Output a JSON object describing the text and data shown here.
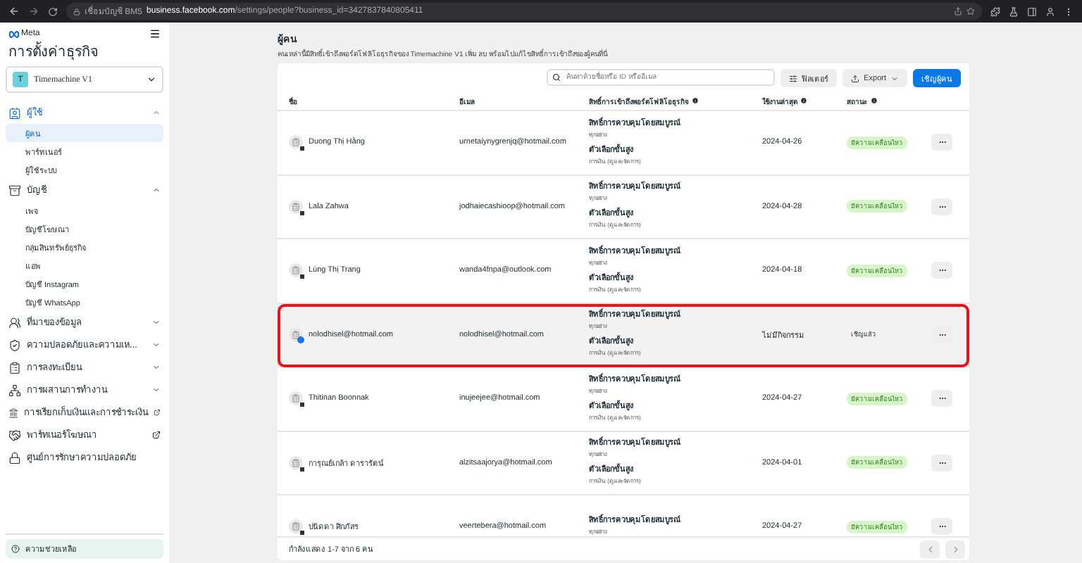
{
  "browser": {
    "site_label": "เชื่อมบัญชี BM5",
    "url_host": "business.facebook.com",
    "url_path": "/settings/people?business_id=3427837840805411"
  },
  "sidebar": {
    "logo": "Meta",
    "title": "การตั้งค่าธุรกิจ",
    "business": {
      "initial": "T",
      "name": "Timemachine V1"
    },
    "sections": [
      {
        "label": "ผู้ใช้",
        "expanded": true,
        "selected": true,
        "external": false,
        "children": [
          {
            "label": "ผู้คน",
            "selected": true
          },
          {
            "label": "พาร์ทเนอร์",
            "selected": false
          },
          {
            "label": "ผู้ใช้ระบบ",
            "selected": false
          }
        ]
      },
      {
        "label": "บัญชี",
        "expanded": true,
        "selected": false,
        "external": false,
        "children": [
          {
            "label": "เพจ",
            "selected": false
          },
          {
            "label": "บัญชีโฆษณา",
            "selected": false
          },
          {
            "label": "กลุ่มสินทรัพย์ธุรกิจ",
            "selected": false
          },
          {
            "label": "แอพ",
            "selected": false
          },
          {
            "label": "บัญชี Instagram",
            "selected": false
          },
          {
            "label": "บัญชี WhatsApp",
            "selected": false
          }
        ]
      },
      {
        "label": "ที่มาของข้อมูล",
        "expanded": false,
        "selected": false,
        "external": false
      },
      {
        "label": "ความปลอดภัยและความเห...",
        "expanded": false,
        "selected": false,
        "external": false
      },
      {
        "label": "การลงทะเบียน",
        "expanded": false,
        "selected": false,
        "external": false
      },
      {
        "label": "การผสานการทำงาน",
        "expanded": false,
        "selected": false,
        "external": false
      },
      {
        "label": "การเรียกเก็บเงินและการชำระเงิน",
        "selected": false,
        "external": true
      },
      {
        "label": "พาร์ทเนอร์โฆษณา",
        "selected": false,
        "external": true
      },
      {
        "label": "ศูนย์การรักษาความปลอดภัย",
        "selected": false,
        "external": false
      }
    ],
    "help": "ความช่วยเหลือ"
  },
  "page": {
    "title": "ผู้คน",
    "subtitle": "คนเหล่านี้มีสิทธิ์เข้าถึงพอร์ตโฟลิโอธุรกิจของ Timemachine V1 เพิ่ม ลบ พร้อมไปแก้ไขสิทธิ์การเข้าถึงของผู้คนที่นี่"
  },
  "toolbar": {
    "search_placeholder": "ค้นหาด้วยชื่อหรือ ID หรืออีเมล",
    "filter": "ฟิลเตอร์",
    "export": "Export",
    "invite": "เชิญผู้คน"
  },
  "table": {
    "columns": [
      {
        "label": "ชื่อ",
        "info": false
      },
      {
        "label": "อีเมล",
        "info": false
      },
      {
        "label": "สิทธิ์การเข้าถึงพอร์ตโฟลิโอธุรกิจ",
        "info": true
      },
      {
        "label": "ใช้งานล่าสุด",
        "info": true
      },
      {
        "label": "สถานะ",
        "info": true
      }
    ],
    "rows": [
      {
        "name": "Duong Thị Hằng",
        "kind": "user",
        "email": "urnetaiynygrenjq@hotmail.com",
        "access": [
          {
            "title": "สิทธิ์การควบคุมโดยสมบูรณ์",
            "detail": "ทุกอย่าง"
          },
          {
            "title": "ตัวเลือกขั้นสูง",
            "detail": "การเงิน (ดูและจัดการ)"
          }
        ],
        "last_used": "2024-04-26",
        "status": {
          "kind": "active",
          "label": "มีความเคลื่อนไหว"
        },
        "highlighted": false
      },
      {
        "name": "Lala Zahwa",
        "kind": "user",
        "email": "jodhaiecashioop@hotmail.com",
        "access": [
          {
            "title": "สิทธิ์การควบคุมโดยสมบูรณ์",
            "detail": "ทุกอย่าง"
          },
          {
            "title": "ตัวเลือกขั้นสูง",
            "detail": "การเงิน (ดูและจัดการ)"
          }
        ],
        "last_used": "2024-04-28",
        "status": {
          "kind": "active",
          "label": "มีความเคลื่อนไหว"
        },
        "highlighted": false
      },
      {
        "name": "Lùng Thị Trang",
        "kind": "user",
        "email": "wanda4fnpa@outlook.com",
        "access": [
          {
            "title": "สิทธิ์การควบคุมโดยสมบูรณ์",
            "detail": "ทุกอย่าง"
          },
          {
            "title": "ตัวเลือกขั้นสูง",
            "detail": "การเงิน (ดูและจัดการ)"
          }
        ],
        "last_used": "2024-04-18",
        "status": {
          "kind": "active",
          "label": "มีความเคลื่อนไหว"
        },
        "highlighted": false
      },
      {
        "name": "nolodhisel@hotmail.com",
        "kind": "facebook",
        "email": "nolodhisel@hotmail.com",
        "access": [
          {
            "title": "สิทธิ์การควบคุมโดยสมบูรณ์",
            "detail": "ทุกอย่าง"
          },
          {
            "title": "ตัวเลือกขั้นสูง",
            "detail": "การเงิน (ดูและจัดการ)"
          }
        ],
        "last_used": "ไม่มีกิจกรรม",
        "status": {
          "kind": "invited",
          "label": "เชิญแล้ว"
        },
        "highlighted": true
      },
      {
        "name": "Thitinan Boonnak",
        "kind": "user",
        "email": "inujeejee@hotmail.com",
        "access": [
          {
            "title": "สิทธิ์การควบคุมโดยสมบูรณ์",
            "detail": "ทุกอย่าง"
          },
          {
            "title": "ตัวเลือกขั้นสูง",
            "detail": "การเงิน (ดูและจัดการ)"
          }
        ],
        "last_used": "2024-04-27",
        "status": {
          "kind": "active",
          "label": "มีความเคลื่อนไหว"
        },
        "highlighted": false
      },
      {
        "name": "การุณย์เกล้า ดารารัตน์",
        "kind": "user",
        "email": "alzitsaajorya@hotmail.com",
        "access": [
          {
            "title": "สิทธิ์การควบคุมโดยสมบูรณ์",
            "detail": "ทุกอย่าง"
          },
          {
            "title": "ตัวเลือกขั้นสูง",
            "detail": "การเงิน (ดูและจัดการ)"
          }
        ],
        "last_used": "2024-04-01",
        "status": {
          "kind": "active",
          "label": "มีความเคลื่อนไหว"
        },
        "highlighted": false
      },
      {
        "name": "ปนัดดา ศิกภัสร",
        "kind": "user",
        "email": "veertebera@hotmail.com",
        "access": [
          {
            "title": "สิทธิ์การควบคุมโดยสมบูรณ์",
            "detail": "ทุกอย่าง"
          }
        ],
        "last_used": "2024-04-27",
        "status": {
          "kind": "active",
          "label": "มีความเคลื่อนไหว"
        },
        "highlighted": false
      }
    ]
  },
  "footer": {
    "summary": "กำลังแสดง 1-7 จาก 6 คน"
  }
}
